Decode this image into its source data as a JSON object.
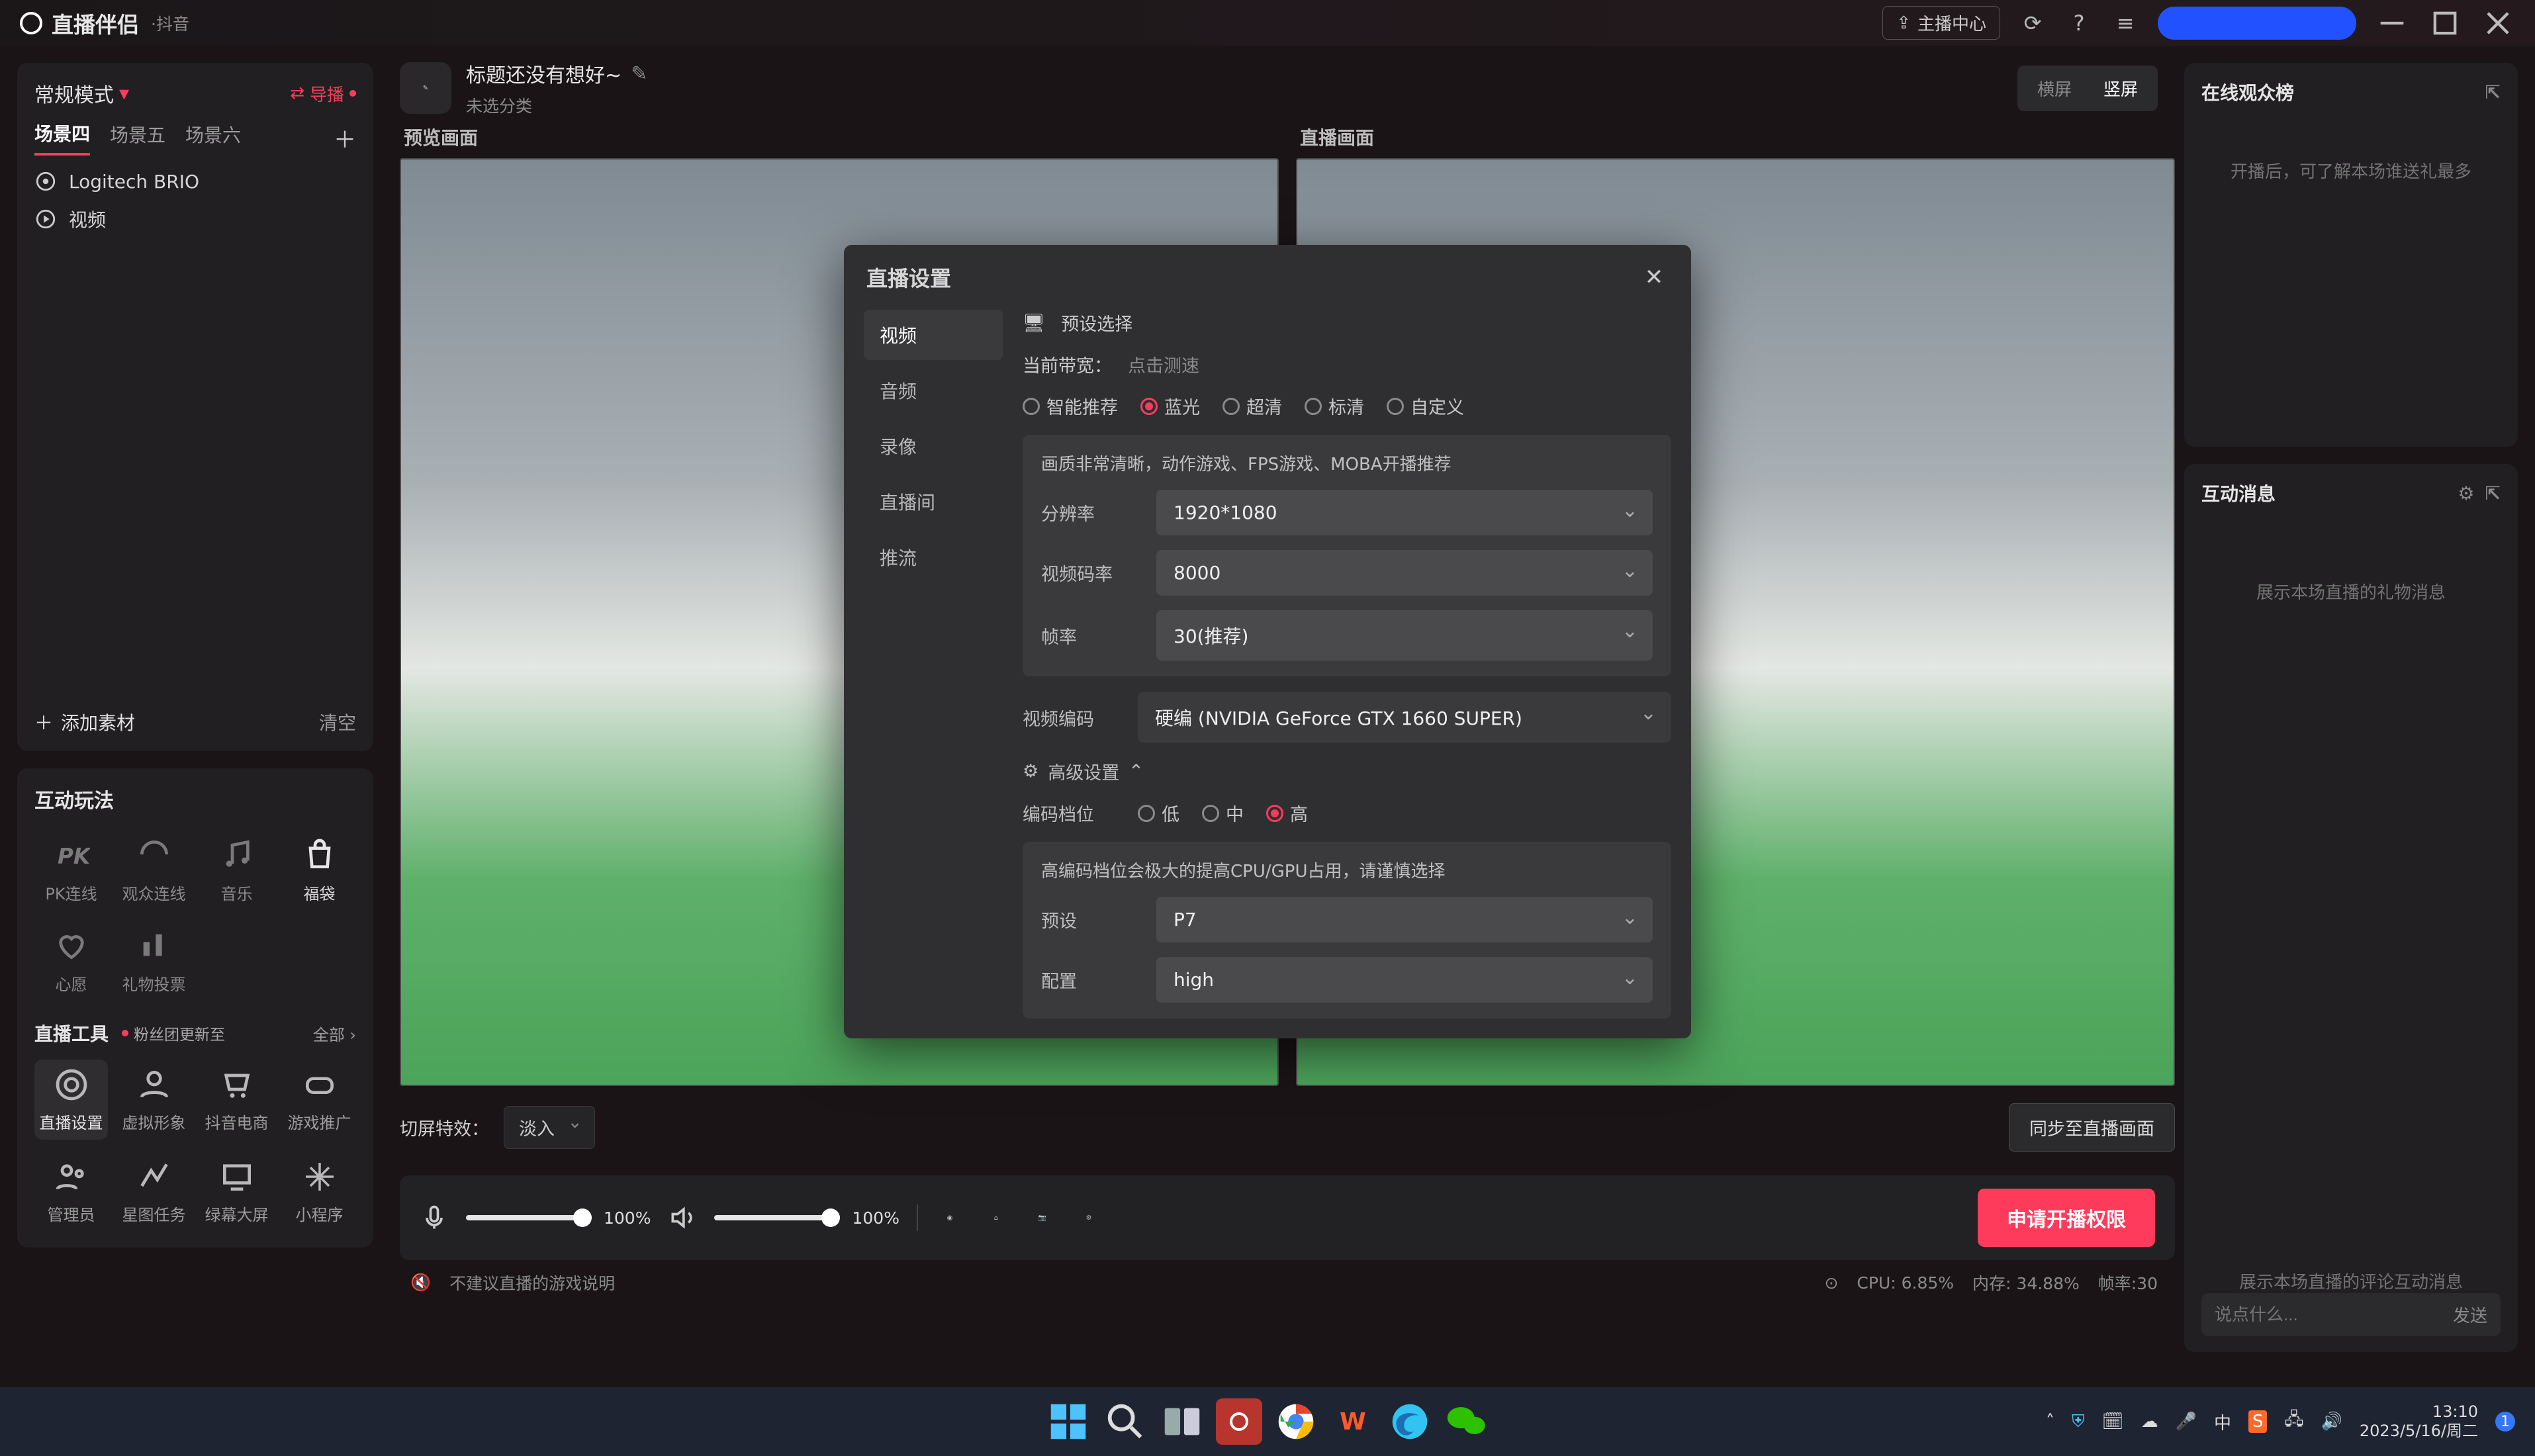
{
  "app": {
    "name": "直播伴侣",
    "subname": "·抖音"
  },
  "titlebar": {
    "anchor_center": "主播中心"
  },
  "sidebar": {
    "mode": "常规模式",
    "guide": "导播",
    "scene_tabs": [
      "场景四",
      "场景五",
      "场景六"
    ],
    "scene_active": 0,
    "sources": [
      {
        "label": "Logitech BRIO",
        "icon": "camera"
      },
      {
        "label": "视频",
        "icon": "video"
      }
    ],
    "add": "添加素材",
    "clear": "清空",
    "play_title": "互动玩法",
    "play_items": [
      {
        "label": "PK连线",
        "enabled": false
      },
      {
        "label": "观众连线",
        "enabled": false
      },
      {
        "label": "音乐",
        "enabled": false
      },
      {
        "label": "福袋",
        "enabled": true
      },
      {
        "label": "心愿",
        "enabled": false
      },
      {
        "label": "礼物投票",
        "enabled": false
      }
    ],
    "tools_title": "直播工具",
    "tools_update": "粉丝团更新至",
    "tools_all": "全部",
    "tools": [
      {
        "label": "直播设置",
        "active": true
      },
      {
        "label": "虚拟形象",
        "active": false
      },
      {
        "label": "抖音电商",
        "active": false
      },
      {
        "label": "游戏推广",
        "active": false
      },
      {
        "label": "管理员",
        "active": false
      },
      {
        "label": "星图任务",
        "active": false
      },
      {
        "label": "绿幕大屏",
        "active": false
      },
      {
        "label": "小程序",
        "active": false
      }
    ]
  },
  "main": {
    "title": "标题还没有想好~",
    "category": "未选分类",
    "orient_options": [
      "横屏",
      "竖屏"
    ],
    "orient_active": 1,
    "preview_label": "预览画面",
    "live_label": "直播画面",
    "transition_label": "切屏特效：",
    "transition_value": "淡入",
    "sync_btn": "同步至直播画面",
    "mic_pct": "100%",
    "spk_pct": "100%",
    "start_btn": "申请开播权限",
    "status_hint": "不建议直播的游戏说明",
    "cpu": "CPU: 6.85%",
    "mem": "内存: 34.88%",
    "fps": "帧率:30"
  },
  "right": {
    "audience_title": "在线观众榜",
    "audience_placeholder": "开播后，可了解本场谁送礼最多",
    "interact_title": "互动消息",
    "interact_placeholder1": "展示本场直播的礼物消息",
    "interact_placeholder2": "展示本场直播的评论互动消息",
    "chat_placeholder": "说点什么...",
    "chat_send": "发送"
  },
  "modal": {
    "title": "直播设置",
    "nav": [
      "视频",
      "音频",
      "录像",
      "直播间",
      "推流"
    ],
    "nav_active": 0,
    "preset_label": "预设选择",
    "bandwidth_label": "当前带宽：",
    "bandwidth_link": "点击测速",
    "quality_options": [
      "智能推荐",
      "蓝光",
      "超清",
      "标清",
      "自定义"
    ],
    "quality_active": 1,
    "card_hint": "画质非常清晰，动作游戏、FPS游戏、MOBA开播推荐",
    "resolution_label": "分辨率",
    "resolution_value": "1920*1080",
    "bitrate_label": "视频码率",
    "bitrate_value": "8000",
    "fps_label": "帧率",
    "fps_value": "30(推荐)",
    "encoder_label": "视频编码",
    "encoder_value": "硬编 (NVIDIA GeForce GTX 1660 SUPER)",
    "advanced_label": "高级设置",
    "enc_level_label": "编码档位",
    "enc_level_options": [
      "低",
      "中",
      "高"
    ],
    "enc_level_active": 2,
    "enc_hint": "高编码档位会极大的提高CPU/GPU占用，请谨慎选择",
    "preset_label2": "预设",
    "preset_value": "P7",
    "profile_label": "配置",
    "profile_value": "high"
  },
  "taskbar": {
    "time": "13:10",
    "date": "2023/5/16/周二",
    "ime": "中"
  }
}
